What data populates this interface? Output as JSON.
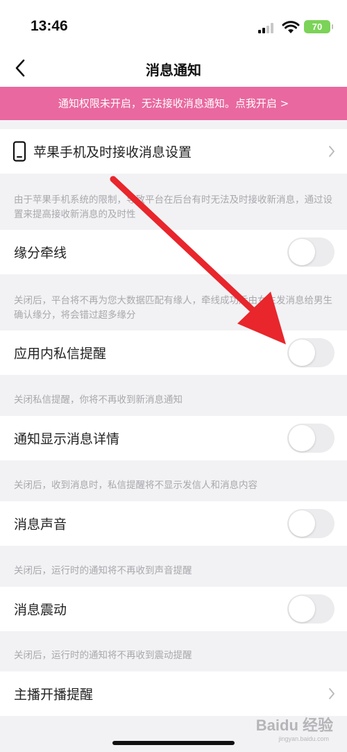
{
  "status_bar": {
    "time": "13:46",
    "battery": "70"
  },
  "nav": {
    "title": "消息通知"
  },
  "banner": {
    "text": "通知权限未开启，无法接收消息通知。点我开启 >"
  },
  "rows": {
    "iphone": {
      "label": "苹果手机及时接收消息设置"
    },
    "yuanfen": {
      "label": "缘分牵线",
      "enabled": false
    },
    "private_msg": {
      "label": "应用内私信提醒",
      "enabled": false
    },
    "detail": {
      "label": "通知显示消息详情",
      "enabled": false
    },
    "sound": {
      "label": "消息声音",
      "enabled": false
    },
    "vibrate": {
      "label": "消息震动",
      "enabled": false
    },
    "live": {
      "label": "主播开播提醒"
    }
  },
  "descriptions": {
    "iphone": "由于苹果手机系统的限制，导致平台在后台有时无法及时接收新消息，通过设置来提高接收新消息的及时性",
    "yuanfen": "关闭后，平台将不再为您大数据匹配有缘人，牵线成功后由女生发消息给男生确认缘分，将会错过超多缘分",
    "private_msg": "关闭私信提醒，你将不再收到新消息通知",
    "detail": "关闭后，收到消息时，私信提醒将不显示发信人和消息内容",
    "sound": "关闭后，运行时的通知将不再收到声音提醒",
    "vibrate": "关闭后，运行时的通知将不再收到震动提醒"
  },
  "watermark": {
    "brand": "Baidu 经验",
    "url": "jingyan.baidu.com"
  },
  "colors": {
    "banner": "#e9689f",
    "arrow": "#e8262c",
    "battery": "#7bd357"
  }
}
